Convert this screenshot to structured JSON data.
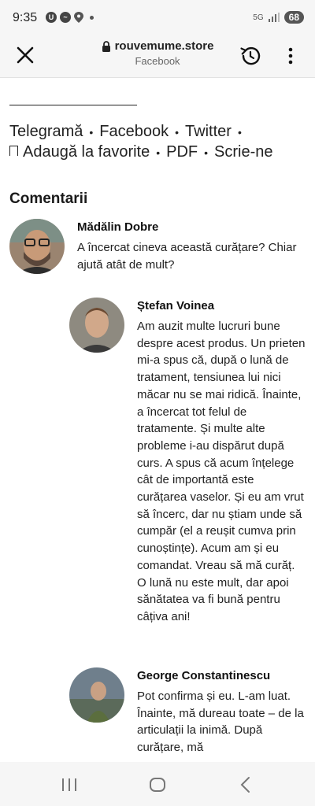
{
  "status_bar": {
    "time": "9:35",
    "battery": "68",
    "network": "5G"
  },
  "browser": {
    "url": "rouvemume.store",
    "subtitle": "Facebook"
  },
  "share": {
    "telegram": "Telegramă",
    "facebook": "Facebook",
    "twitter": "Twitter",
    "favorites": "Adaugă la favorite",
    "pdf": "PDF",
    "contact": "Scrie-ne",
    "separator": "•"
  },
  "comments_title": "Comentarii",
  "comments": [
    {
      "name": "Mădălin Dobre",
      "text": "A încercat cineva această curățare? Chiar ajută atât de mult?"
    },
    {
      "name": "Ștefan Voinea",
      "text": "Am auzit multe lucruri bune despre acest produs. Un prieten mi-a spus că, după o lună de tratament, tensiunea lui nici măcar nu se mai ridică. Înainte, a încercat tot felul de tratamente. Și multe alte probleme i-au dispărut după curs. A spus că acum înțelege cât de importantă este curățarea vaselor. Și eu am vrut să încerc, dar nu știam unde să cumpăr (el a reușit cumva prin cunoștințe). Acum am și eu comandat. Vreau să mă curăț. O lună nu este mult, dar apoi sănătatea va fi bună pentru câțiva ani!"
    },
    {
      "name": "George Constantinescu",
      "text": "Pot confirma și eu. L-am luat. Înainte, mă dureau toate – de la articulații la inimă. După curățare, mă"
    }
  ],
  "colors": {
    "bar_bg": "#f6f6f6",
    "text": "#222222"
  }
}
